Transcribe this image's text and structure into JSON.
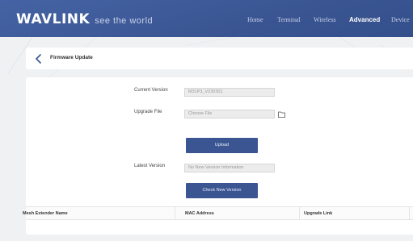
{
  "header": {
    "brand": "WAVLINK",
    "tagline": "see the world",
    "nav": [
      {
        "label": "Home",
        "active": false
      },
      {
        "label": "Terminal",
        "active": false
      },
      {
        "label": "Wireless",
        "active": false
      },
      {
        "label": "Advanced",
        "active": true
      },
      {
        "label": "Device",
        "active": false
      }
    ],
    "bar_color": "#3f5a9a"
  },
  "page": {
    "title": "Firmware Update",
    "back_icon": "chevron-left-icon"
  },
  "form": {
    "current_version_label": "Current Version",
    "current_version_value": "M31P3_V230301",
    "upgrade_file_label": "Upgrade File",
    "upgrade_file_placeholder": "Choose File",
    "folder_icon": "folder-icon",
    "upload_label": "Upload",
    "latest_version_label": "Latest Version",
    "latest_version_value": "No New Version Information",
    "check_label": "Check New Version",
    "button_color": "#3a5592"
  },
  "table": {
    "columns": [
      "Mesh Extender Name",
      "MAC Address",
      "Upgrade Link"
    ],
    "rows": []
  }
}
